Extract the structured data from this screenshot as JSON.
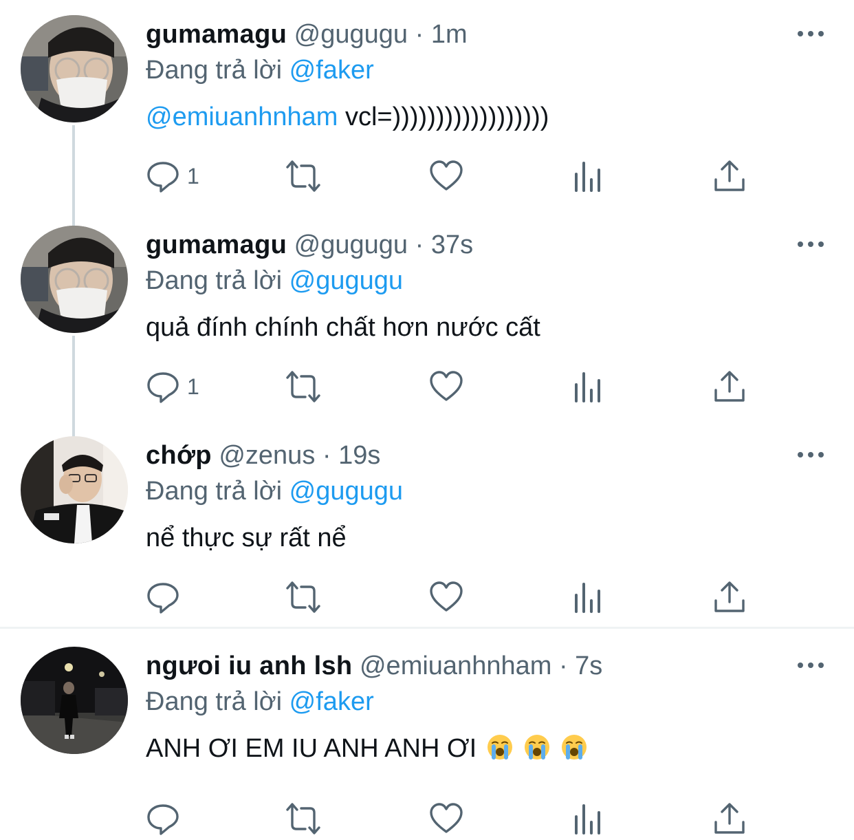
{
  "tweets": [
    {
      "display_name": "gumamagu",
      "handle": "@gugugu",
      "time": "1m",
      "reply_prefix": "Đang trả lời",
      "reply_to": "@faker",
      "body_mention": "@emiuanhnham",
      "body_text": " vcl=))))))))))))))))))",
      "reply_count": "1"
    },
    {
      "display_name": "gumamagu",
      "handle": "@gugugu",
      "time": "37s",
      "reply_prefix": "Đang trả lời",
      "reply_to": "@gugugu",
      "body_mention": "",
      "body_text": "quả đính chính chất hơn nước cất",
      "reply_count": "1"
    },
    {
      "display_name": "chớp",
      "handle": "@zenus",
      "time": "19s",
      "reply_prefix": "Đang trả lời",
      "reply_to": "@gugugu",
      "body_mention": "",
      "body_text": "nể thực sự rất nể",
      "reply_count": ""
    },
    {
      "display_name": "ngưoi iu anh lsh",
      "handle": "@emiuanhnham",
      "time": "7s",
      "reply_prefix": "Đang trả lời",
      "reply_to": "@faker",
      "body_mention": "",
      "body_text": "ANH ƠI EM IU ANH ANH ƠI",
      "reply_count": ""
    }
  ],
  "separator": "·",
  "icons": {
    "reply": "reply-icon",
    "retweet": "retweet-icon",
    "like": "heart-icon",
    "views": "analytics-icon",
    "share": "share-icon",
    "more": "more-dots-icon",
    "emoji": "loudly-crying-face-emoji"
  },
  "colors": {
    "accent": "#1d9bf0",
    "muted": "#536471",
    "text": "#0f1419",
    "thread_line": "#cfd9de"
  }
}
